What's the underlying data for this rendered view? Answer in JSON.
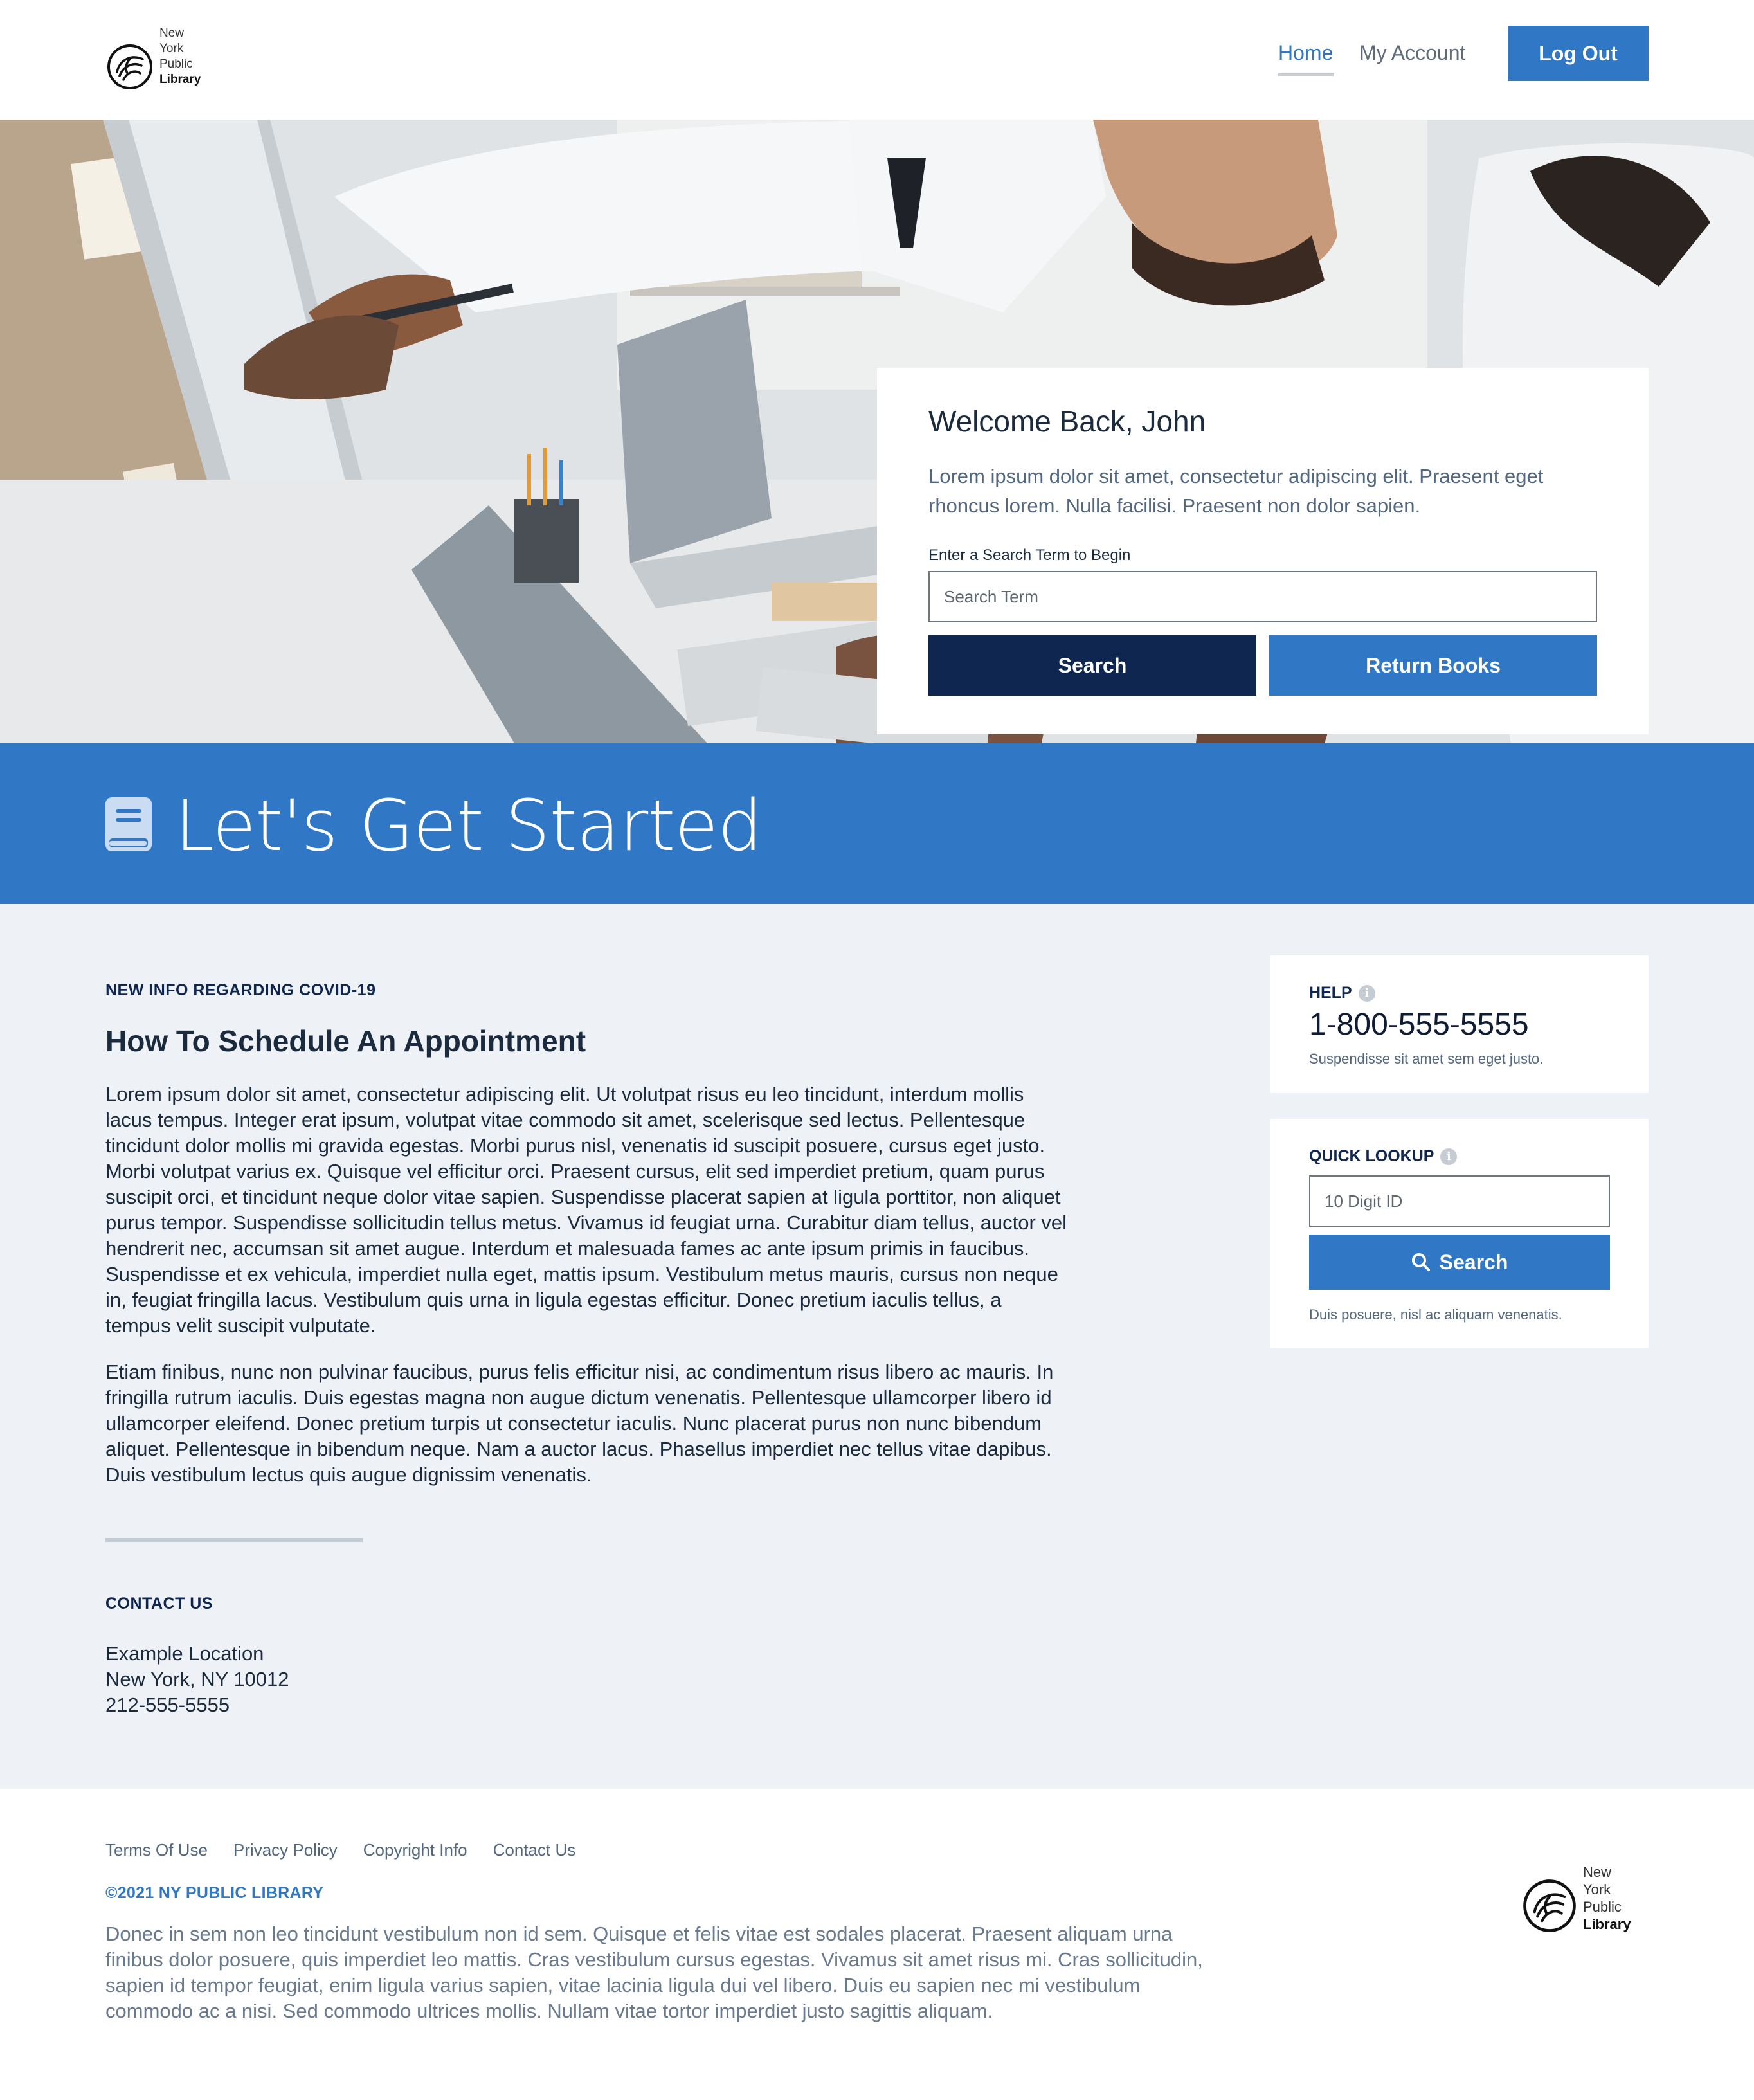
{
  "header": {
    "logo_line1": "New York",
    "logo_line2": "Public",
    "logo_line3": "Library",
    "nav": {
      "home": "Home",
      "account": "My Account"
    },
    "logout_label": "Log Out"
  },
  "hero": {
    "title": "Welcome Back, John",
    "text": "Lorem ipsum dolor sit amet, consectetur adipiscing elit. Praesent eget rhoncus lorem. Nulla facilisi. Praesent non dolor sapien.",
    "search_label": "Enter a Search Term to Begin",
    "search_placeholder": "Search Term",
    "search_button": "Search",
    "return_button": "Return Books"
  },
  "banner": {
    "title": "Let's Get Started",
    "icon": "book-icon"
  },
  "article": {
    "eyebrow": "NEW INFO REGARDING COVID-19",
    "title": "How To Schedule An Appointment",
    "para1": "Lorem ipsum dolor sit amet, consectetur adipiscing elit. Ut volutpat risus eu leo tincidunt, interdum mollis lacus tempus. Integer erat ipsum, volutpat vitae commodo sit amet, scelerisque sed lectus. Pellentesque tincidunt dolor mollis mi gravida egestas. Morbi purus nisl, venenatis id suscipit posuere, cursus eget justo. Morbi volutpat varius ex. Quisque vel efficitur orci. Praesent cursus, elit sed imperdiet pretium, quam purus suscipit orci, et tincidunt neque dolor vitae sapien. Suspendisse placerat sapien at ligula porttitor, non aliquet purus tempor. Suspendisse sollicitudin tellus metus. Vivamus id feugiat urna. Curabitur diam tellus, auctor vel hendrerit nec, accumsan sit amet augue. Interdum et malesuada fames ac ante ipsum primis in faucibus. Suspendisse et ex vehicula, imperdiet nulla eget, mattis ipsum. Vestibulum metus mauris, cursus non neque in, feugiat fringilla lacus. Vestibulum quis urna in ligula egestas efficitur. Donec pretium iaculis tellus, a tempus velit suscipit vulputate.",
    "para2": "Etiam finibus, nunc non pulvinar faucibus, purus felis efficitur nisi, ac condimentum risus libero ac mauris. In fringilla rutrum iaculis. Duis egestas magna non augue dictum venenatis. Pellentesque ullamcorper libero id ullamcorper eleifend. Donec pretium turpis ut consectetur iaculis. Nunc placerat purus non nunc bibendum aliquet. Pellentesque in bibendum neque. Nam a auctor lacus. Phasellus imperdiet nec tellus vitae dapibus. Duis vestibulum lectus quis augue dignissim venenatis."
  },
  "contact": {
    "eyebrow": "CONTACT US",
    "line1": "Example Location",
    "line2": "New York, NY 10012",
    "line3": "212-555-5555"
  },
  "sidebar": {
    "help": {
      "eyebrow": "HELP",
      "info": "i",
      "phone": "1-800-555-5555",
      "note": "Suspendisse sit amet sem eget justo."
    },
    "lookup": {
      "eyebrow": "QUICK LOOKUP",
      "info": "i",
      "placeholder": "10 Digit ID",
      "button": "Search",
      "note": "Duis posuere, nisl ac aliquam venenatis."
    }
  },
  "footer": {
    "links": [
      "Terms Of Use",
      "Privacy Policy",
      "Copyright Info",
      "Contact Us"
    ],
    "copyright": "©2021 NY PUBLIC LIBRARY",
    "text": "Donec in sem non leo tincidunt vestibulum non id sem. Quisque et felis vitae est sodales placerat. Praesent aliquam urna finibus dolor posuere, quis imperdiet leo mattis. Cras vestibulum cursus egestas. Vivamus sit amet risus mi. Cras sollicitudin, sapien id tempor feugiat, enim ligula varius sapien, vitae lacinia ligula dui vel libero. Duis eu sapien nec mi vestibulum commodo ac a nisi. Sed commodo ultrices mollis. Nullam vitae tortor imperdiet justo sagittis aliquam.",
    "logo_line1": "New York",
    "logo_line2": "Public",
    "logo_line3": "Library"
  },
  "colors": {
    "primary": "#3078c6",
    "navy": "#0f2650",
    "page_bg": "#eef2f6"
  }
}
